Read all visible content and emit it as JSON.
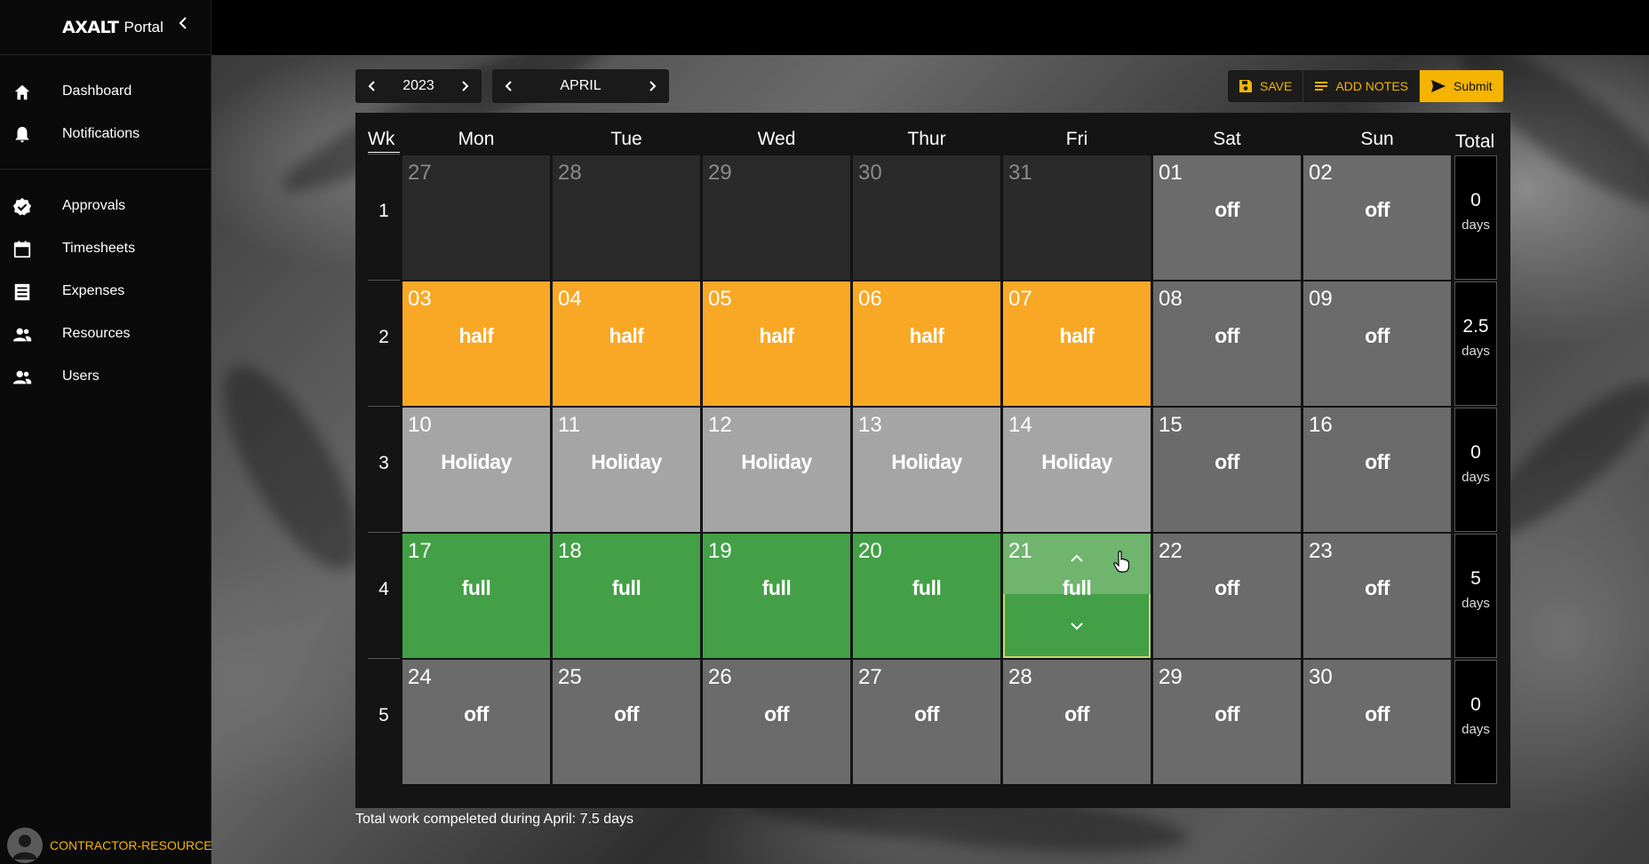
{
  "brand": {
    "logo": "AXALT",
    "text": "Portal"
  },
  "nav": {
    "main": [
      {
        "label": "Dashboard",
        "icon": "home-icon"
      },
      {
        "label": "Notifications",
        "icon": "bell-icon"
      }
    ],
    "secondary": [
      {
        "label": "Approvals",
        "icon": "check-badge-icon"
      },
      {
        "label": "Timesheets",
        "icon": "calendar-icon"
      },
      {
        "label": "Expenses",
        "icon": "receipt-icon"
      },
      {
        "label": "Resources",
        "icon": "people-icon"
      },
      {
        "label": "Users",
        "icon": "people-icon"
      }
    ]
  },
  "user": {
    "role": "CONTRACTOR-RESOURCE"
  },
  "controls": {
    "year": "2023",
    "month": "APRIL"
  },
  "actions": {
    "save": "SAVE",
    "add_notes": "ADD NOTES",
    "submit": "Submit"
  },
  "calendar": {
    "wk_header": "Wk",
    "total_header": "Total",
    "days": [
      "Mon",
      "Tue",
      "Wed",
      "Thur",
      "Fri",
      "Sat",
      "Sun"
    ],
    "weeks": [
      {
        "num": "1",
        "total": "0",
        "unit": "days",
        "cells": [
          {
            "d": "27",
            "s": "",
            "t": "other"
          },
          {
            "d": "28",
            "s": "",
            "t": "other"
          },
          {
            "d": "29",
            "s": "",
            "t": "other"
          },
          {
            "d": "30",
            "s": "",
            "t": "other"
          },
          {
            "d": "31",
            "s": "",
            "t": "other"
          },
          {
            "d": "01",
            "s": "off",
            "t": "off"
          },
          {
            "d": "02",
            "s": "off",
            "t": "off"
          }
        ]
      },
      {
        "num": "2",
        "total": "2.5",
        "unit": "days",
        "cells": [
          {
            "d": "03",
            "s": "half",
            "t": "half"
          },
          {
            "d": "04",
            "s": "half",
            "t": "half"
          },
          {
            "d": "05",
            "s": "half",
            "t": "half"
          },
          {
            "d": "06",
            "s": "half",
            "t": "half"
          },
          {
            "d": "07",
            "s": "half",
            "t": "half"
          },
          {
            "d": "08",
            "s": "off",
            "t": "off"
          },
          {
            "d": "09",
            "s": "off",
            "t": "off"
          }
        ]
      },
      {
        "num": "3",
        "total": "0",
        "unit": "days",
        "cells": [
          {
            "d": "10",
            "s": "Holiday",
            "t": "hol"
          },
          {
            "d": "11",
            "s": "Holiday",
            "t": "hol"
          },
          {
            "d": "12",
            "s": "Holiday",
            "t": "hol"
          },
          {
            "d": "13",
            "s": "Holiday",
            "t": "hol"
          },
          {
            "d": "14",
            "s": "Holiday",
            "t": "hol"
          },
          {
            "d": "15",
            "s": "off",
            "t": "off"
          },
          {
            "d": "16",
            "s": "off",
            "t": "off"
          }
        ]
      },
      {
        "num": "4",
        "total": "5",
        "unit": "days",
        "cells": [
          {
            "d": "17",
            "s": "full",
            "t": "full"
          },
          {
            "d": "18",
            "s": "full",
            "t": "full"
          },
          {
            "d": "19",
            "s": "full",
            "t": "full"
          },
          {
            "d": "20",
            "s": "full",
            "t": "full"
          },
          {
            "d": "21",
            "s": "full",
            "t": "full",
            "selected": true
          },
          {
            "d": "22",
            "s": "off",
            "t": "off"
          },
          {
            "d": "23",
            "s": "off",
            "t": "off"
          }
        ]
      },
      {
        "num": "5",
        "total": "0",
        "unit": "days",
        "cells": [
          {
            "d": "24",
            "s": "off",
            "t": "off"
          },
          {
            "d": "25",
            "s": "off",
            "t": "off"
          },
          {
            "d": "26",
            "s": "off",
            "t": "off"
          },
          {
            "d": "27",
            "s": "off",
            "t": "off"
          },
          {
            "d": "28",
            "s": "off",
            "t": "off"
          },
          {
            "d": "29",
            "s": "off",
            "t": "off"
          },
          {
            "d": "30",
            "s": "off",
            "t": "off"
          }
        ]
      }
    ]
  },
  "footer": {
    "summary": "Total work compeleted during April: 7.5 days"
  },
  "colors": {
    "accent": "#f4b400",
    "half": "#f9a825",
    "full": "#43a047",
    "holiday": "#a5a5a5",
    "off": "#6b6b6b"
  }
}
